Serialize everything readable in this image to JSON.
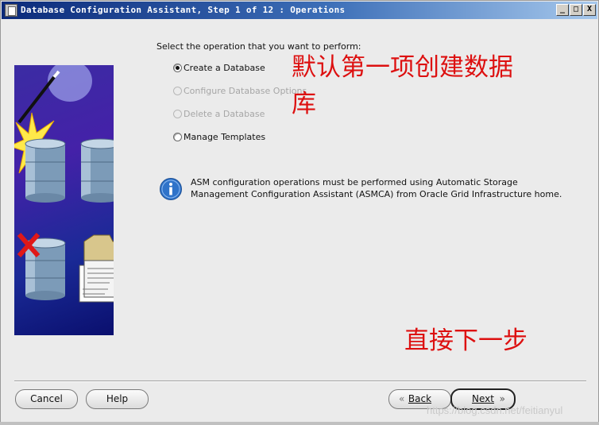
{
  "window": {
    "title": "Database Configuration Assistant, Step 1 of 12 : Operations",
    "controls": {
      "minimize": "_",
      "maximize": "□",
      "close": "X"
    }
  },
  "main": {
    "prompt": "Select the operation that you want to perform:",
    "options": [
      {
        "label": "Create a Database",
        "selected": true,
        "enabled": true
      },
      {
        "label": "Configure Database Options",
        "selected": false,
        "enabled": false
      },
      {
        "label": "Delete a Database",
        "selected": false,
        "enabled": false
      },
      {
        "label": "Manage Templates",
        "selected": false,
        "enabled": true
      }
    ],
    "info": {
      "icon": "info-icon",
      "line1": "ASM configuration operations must be performed using Automatic Storage",
      "line2": "Management Configuration Assistant (ASMCA) from Oracle Grid Infrastructure home."
    }
  },
  "annotations": {
    "note1_line1": "默认第一项创建数据",
    "note1_line2": "库",
    "note2": "直接下一步",
    "color": "#dd1010"
  },
  "footer": {
    "cancel": "Cancel",
    "help": "Help",
    "back": "Back",
    "next": "Next",
    "back_arrow": "«",
    "next_arrow": "»"
  },
  "watermark": "https://blog.csdn.net/feitianyul",
  "colors": {
    "titlebar_start": "#0b2a7a",
    "titlebar_end": "#a6c8ec",
    "panel_bg": "#ebebeb",
    "side_panel": "#2a2a9e"
  }
}
